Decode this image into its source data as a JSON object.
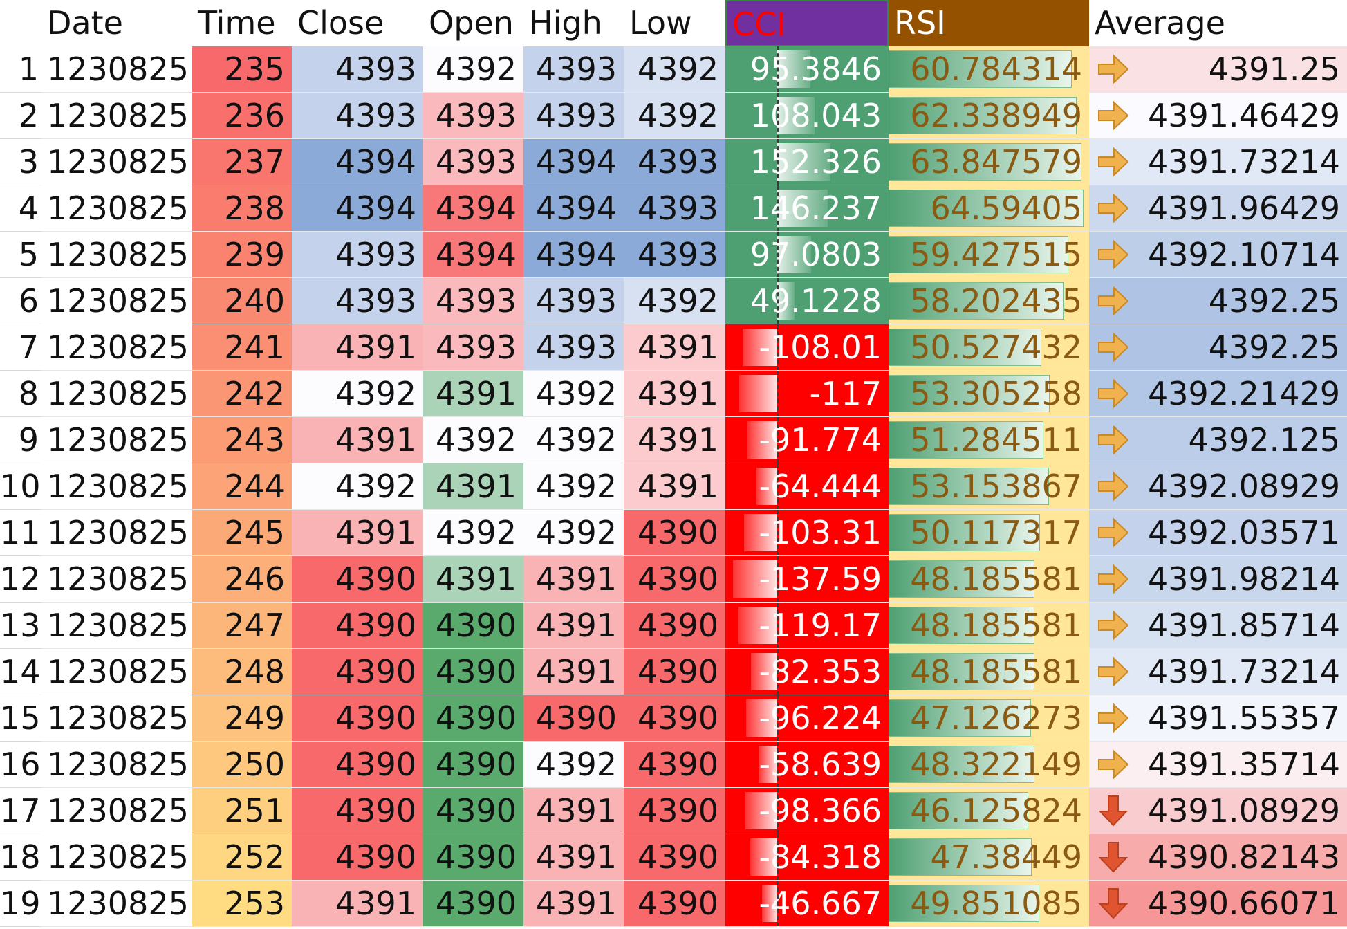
{
  "columns": {
    "date": "Date",
    "time": "Time",
    "close": "Close",
    "open": "Open",
    "high": "High",
    "low": "Low",
    "cci": "CCI",
    "rsi": "RSI",
    "average": "Average"
  },
  "colors": {
    "cci_header_bg": "#7030a0",
    "cci_header_text": "#ff0000",
    "rsi_header_bg": "#945200",
    "cci_positive_bg": "#4ea072",
    "cci_negative_bg": "#ff0000",
    "rsi_text": "#8a5a12",
    "arrow_side": "#f0b24f",
    "arrow_down": "#e0552f"
  },
  "rows": [
    {
      "n": "1",
      "date": "1230825",
      "time": "235",
      "close": "4393",
      "open": "4392",
      "high": "4393",
      "low": "4392",
      "cci": "95.3846",
      "rsi": "60.784314",
      "trend": "side",
      "average": "4391.25"
    },
    {
      "n": "2",
      "date": "1230825",
      "time": "236",
      "close": "4393",
      "open": "4393",
      "high": "4393",
      "low": "4392",
      "cci": "108.043",
      "rsi": "62.338949",
      "trend": "side",
      "average": "4391.46429"
    },
    {
      "n": "3",
      "date": "1230825",
      "time": "237",
      "close": "4394",
      "open": "4393",
      "high": "4394",
      "low": "4393",
      "cci": "152.326",
      "rsi": "63.847579",
      "trend": "side",
      "average": "4391.73214"
    },
    {
      "n": "4",
      "date": "1230825",
      "time": "238",
      "close": "4394",
      "open": "4394",
      "high": "4394",
      "low": "4393",
      "cci": "146.237",
      "rsi": "64.59405",
      "trend": "side",
      "average": "4391.96429"
    },
    {
      "n": "5",
      "date": "1230825",
      "time": "239",
      "close": "4393",
      "open": "4394",
      "high": "4394",
      "low": "4393",
      "cci": "97.0803",
      "rsi": "59.427515",
      "trend": "side",
      "average": "4392.10714"
    },
    {
      "n": "6",
      "date": "1230825",
      "time": "240",
      "close": "4393",
      "open": "4393",
      "high": "4393",
      "low": "4392",
      "cci": "49.1228",
      "rsi": "58.202435",
      "trend": "side",
      "average": "4392.25"
    },
    {
      "n": "7",
      "date": "1230825",
      "time": "241",
      "close": "4391",
      "open": "4393",
      "high": "4393",
      "low": "4391",
      "cci": "-108.01",
      "rsi": "50.527432",
      "trend": "side",
      "average": "4392.25"
    },
    {
      "n": "8",
      "date": "1230825",
      "time": "242",
      "close": "4392",
      "open": "4391",
      "high": "4392",
      "low": "4391",
      "cci": "-117",
      "rsi": "53.305258",
      "trend": "side",
      "average": "4392.21429"
    },
    {
      "n": "9",
      "date": "1230825",
      "time": "243",
      "close": "4391",
      "open": "4392",
      "high": "4392",
      "low": "4391",
      "cci": "-91.774",
      "rsi": "51.284511",
      "trend": "side",
      "average": "4392.125"
    },
    {
      "n": "10",
      "date": "1230825",
      "time": "244",
      "close": "4392",
      "open": "4391",
      "high": "4392",
      "low": "4391",
      "cci": "-64.444",
      "rsi": "53.153867",
      "trend": "side",
      "average": "4392.08929"
    },
    {
      "n": "11",
      "date": "1230825",
      "time": "245",
      "close": "4391",
      "open": "4392",
      "high": "4392",
      "low": "4390",
      "cci": "-103.31",
      "rsi": "50.117317",
      "trend": "side",
      "average": "4392.03571"
    },
    {
      "n": "12",
      "date": "1230825",
      "time": "246",
      "close": "4390",
      "open": "4391",
      "high": "4391",
      "low": "4390",
      "cci": "-137.59",
      "rsi": "48.185581",
      "trend": "side",
      "average": "4391.98214"
    },
    {
      "n": "13",
      "date": "1230825",
      "time": "247",
      "close": "4390",
      "open": "4390",
      "high": "4391",
      "low": "4390",
      "cci": "-119.17",
      "rsi": "48.185581",
      "trend": "side",
      "average": "4391.85714"
    },
    {
      "n": "14",
      "date": "1230825",
      "time": "248",
      "close": "4390",
      "open": "4390",
      "high": "4391",
      "low": "4390",
      "cci": "-82.353",
      "rsi": "48.185581",
      "trend": "side",
      "average": "4391.73214"
    },
    {
      "n": "15",
      "date": "1230825",
      "time": "249",
      "close": "4390",
      "open": "4390",
      "high": "4390",
      "low": "4390",
      "cci": "-96.224",
      "rsi": "47.126273",
      "trend": "side",
      "average": "4391.55357"
    },
    {
      "n": "16",
      "date": "1230825",
      "time": "250",
      "close": "4390",
      "open": "4390",
      "high": "4392",
      "low": "4390",
      "cci": "-58.639",
      "rsi": "48.322149",
      "trend": "side",
      "average": "4391.35714"
    },
    {
      "n": "17",
      "date": "1230825",
      "time": "251",
      "close": "4390",
      "open": "4390",
      "high": "4391",
      "low": "4390",
      "cci": "-98.366",
      "rsi": "46.125824",
      "trend": "down",
      "average": "4391.08929"
    },
    {
      "n": "18",
      "date": "1230825",
      "time": "252",
      "close": "4390",
      "open": "4390",
      "high": "4391",
      "low": "4390",
      "cci": "-84.318",
      "rsi": "47.38449",
      "trend": "down",
      "average": "4390.82143"
    },
    {
      "n": "19",
      "date": "1230825",
      "time": "253",
      "close": "4391",
      "open": "4390",
      "high": "4391",
      "low": "4390",
      "cci": "-46.667",
      "rsi": "49.851085",
      "trend": "down",
      "average": "4390.66071"
    }
  ]
}
